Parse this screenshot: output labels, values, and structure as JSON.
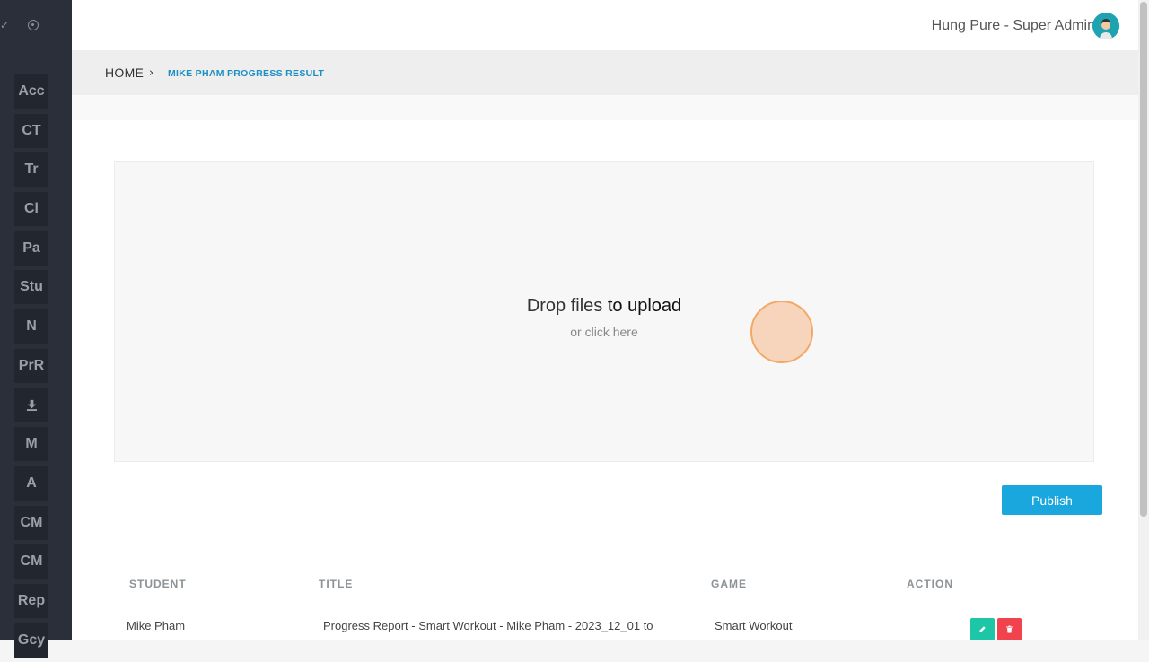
{
  "sidebar": {
    "items": [
      {
        "label": "Acc"
      },
      {
        "label": "CT"
      },
      {
        "label": "Tr"
      },
      {
        "label": "Cl"
      },
      {
        "label": "Pa"
      },
      {
        "label": "Stu"
      },
      {
        "label": "N"
      },
      {
        "label": "PrR"
      },
      {
        "label": "",
        "icon": "download-icon"
      },
      {
        "label": "M"
      },
      {
        "label": "A"
      },
      {
        "label": "CM"
      },
      {
        "label": "CM"
      },
      {
        "label": "Rep"
      },
      {
        "label": "Gcy"
      }
    ]
  },
  "header": {
    "user": "Hung Pure - Super Admin"
  },
  "breadcrumb": {
    "home": "HOME",
    "separator": "›",
    "current": "MIKE PHAM PROGRESS RESULT"
  },
  "dropzone": {
    "title_a": "Drop files",
    "title_b": "to upload",
    "subtitle": "or click here"
  },
  "publish_label": "Publish",
  "table": {
    "headers": {
      "student": "STUDENT",
      "title": "TITLE",
      "game": "GAME",
      "action": "ACTION"
    },
    "rows": [
      {
        "student": "Mike Pham",
        "title": "Progress Report - Smart Workout - Mike Pham - 2023_12_01 to",
        "game": "Smart Workout"
      }
    ]
  },
  "colors": {
    "accent": "#1aa7dd",
    "sidebar": "#2b2f3a",
    "edit": "#1cc6a6",
    "delete": "#f0434d",
    "breadcrumb_active": "#1a8fc4"
  }
}
